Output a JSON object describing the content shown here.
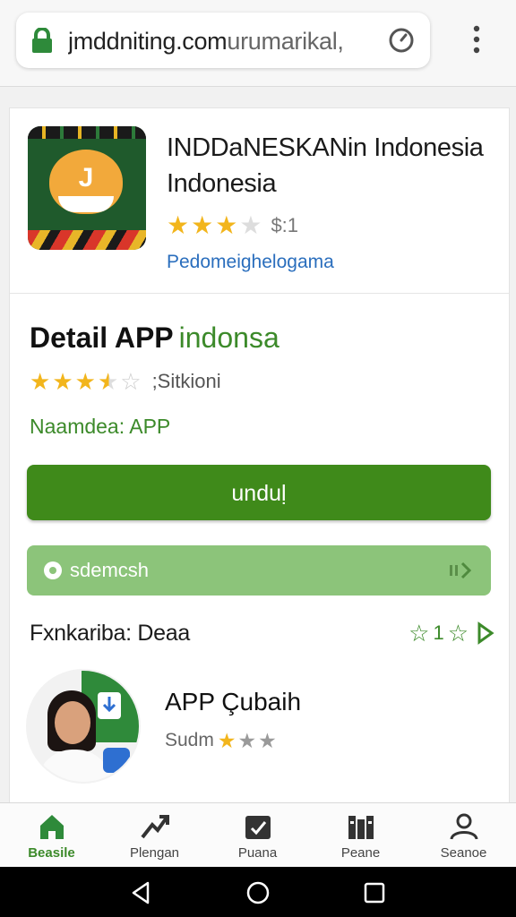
{
  "browser": {
    "url": "jmddniting.com",
    "url_suffix": "urumarikal,"
  },
  "app": {
    "title": "INDDaNESKANin Indonesia Indonesia",
    "rating_label": "$:1",
    "stars": 3,
    "developer": "Pedomeighelogama"
  },
  "detail": {
    "title": "Detail APP",
    "subtitle": "indonsa",
    "stars": 3.5,
    "rating_label": ";Sitkioni",
    "category": "Naamdea: APP"
  },
  "actions": {
    "install_label": "unduḷ",
    "share_label": "sdemcsh"
  },
  "meta": {
    "text": "Fxnkariba: Deaa",
    "count": "1"
  },
  "related": {
    "title": "APP Çubaih",
    "rating_label": "Sudm",
    "stars": 1
  },
  "bottom_nav": [
    {
      "label": "Beasile",
      "icon": "home-icon",
      "active": true
    },
    {
      "label": "Plengan",
      "icon": "trending-icon",
      "active": false
    },
    {
      "label": "Puana",
      "icon": "tasks-icon",
      "active": false
    },
    {
      "label": "Peane",
      "icon": "books-icon",
      "active": false
    },
    {
      "label": "Seanoe",
      "icon": "person-icon",
      "active": false
    }
  ],
  "colors": {
    "accent_green": "#3f8a1a",
    "light_green": "#8cc47a",
    "star_gold": "#f2b51c",
    "link_blue": "#2a6ebd"
  }
}
